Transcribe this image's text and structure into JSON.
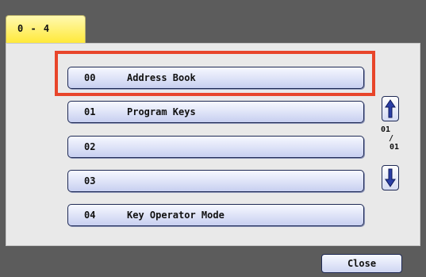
{
  "tab": {
    "label": "0 - 4"
  },
  "list": {
    "items": [
      {
        "num": "00",
        "label": "Address Book"
      },
      {
        "num": "01",
        "label": "Program Keys"
      },
      {
        "num": "02",
        "label": ""
      },
      {
        "num": "03",
        "label": ""
      },
      {
        "num": "04",
        "label": "Key Operator Mode"
      }
    ]
  },
  "pager": {
    "current": "01",
    "separator": "/",
    "total": "01"
  },
  "icons": {
    "up": "arrow-up-icon",
    "down": "arrow-down-icon"
  },
  "colors": {
    "highlight": "#e8452a",
    "tab": "#ffe93a",
    "button": "#dde2f7"
  },
  "footer": {
    "close_label": "Close"
  }
}
